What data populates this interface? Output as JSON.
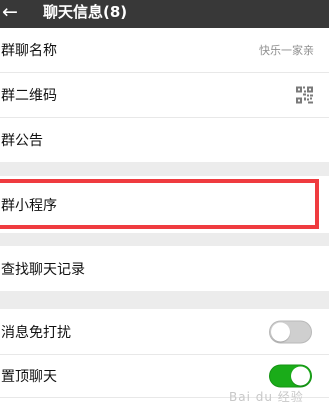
{
  "header": {
    "back_icon": "←",
    "title": "聊天信息(8)"
  },
  "settings": {
    "group_name": {
      "label": "群聊名称",
      "value": "快乐一家亲"
    },
    "group_qr_code": {
      "label": "群二维码",
      "icon": "qr-code-icon"
    },
    "group_notice": {
      "label": "群公告"
    },
    "group_mini_program": {
      "label": "群小程序"
    },
    "search_chat_history": {
      "label": "查找聊天记录"
    },
    "mute_notifications": {
      "label": "消息免打扰",
      "enabled": false
    },
    "pin_chat": {
      "label": "置顶聊天",
      "enabled": true
    }
  },
  "colors": {
    "header_bg": "#383838",
    "accent_green": "#1aac19",
    "highlight_red": "#ef3b3f",
    "separator_gray": "#ececec"
  }
}
